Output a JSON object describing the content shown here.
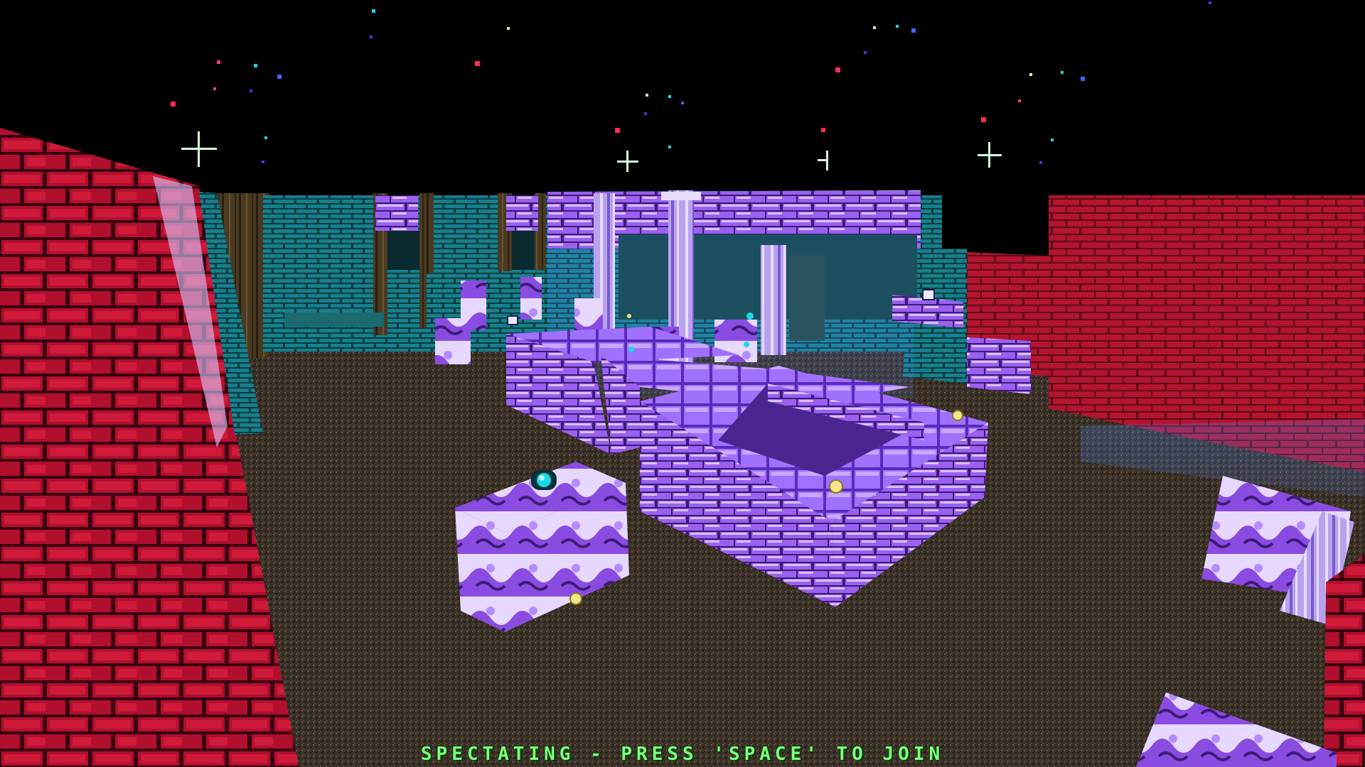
{
  "hud": {
    "spectating_message": "SPECTATING - PRESS 'SPACE' TO JOIN"
  },
  "colors": {
    "sky": "#000000",
    "floor": "#3a3128",
    "red_wall": "#b0102e",
    "red_wall_dark": "#3a0010",
    "teal_wall": "#11606a",
    "wood_wall": "#4a3a22",
    "purple_brick": "#8a4ce0",
    "purple_light": "#c9a6ff",
    "hud_text": "#7dff7d",
    "pickup_yellow": "#f3e58a",
    "powerup_cyan": "#1ad8e6"
  },
  "icons": {
    "powerup": "cyan-orb-icon",
    "pickup": "yellow-orb-icon"
  }
}
